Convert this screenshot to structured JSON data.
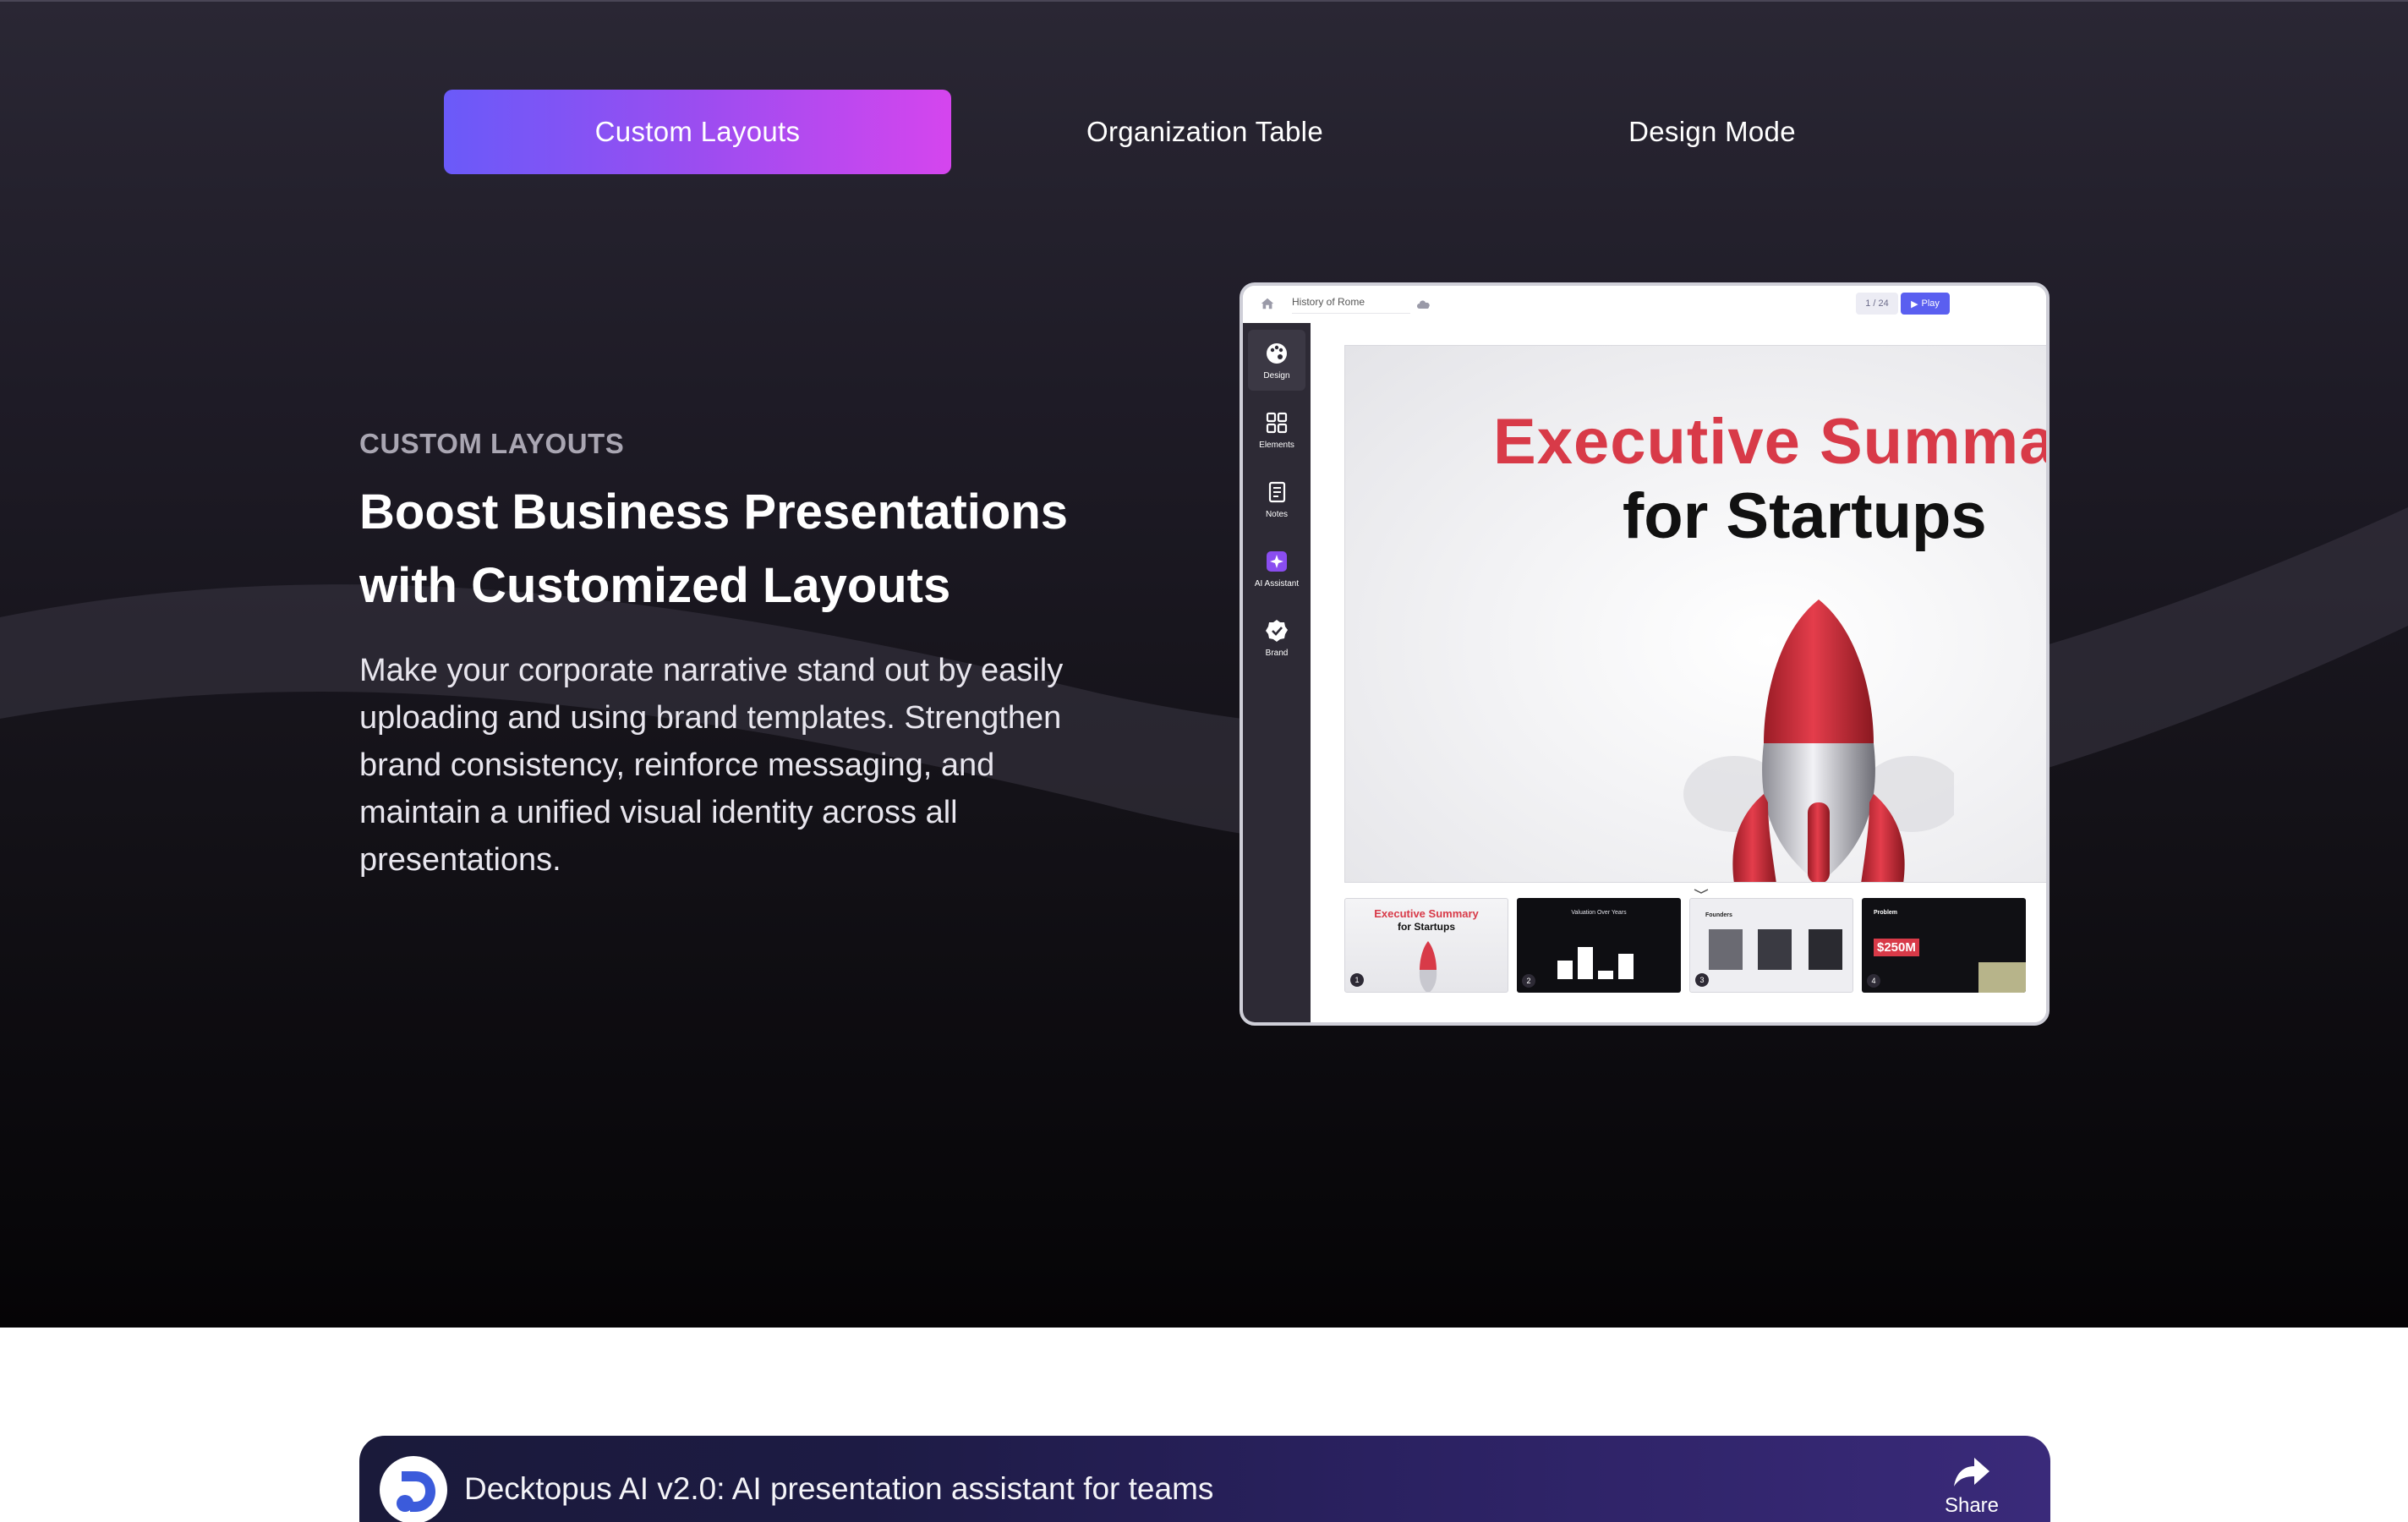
{
  "tabs": [
    {
      "label": "Custom Layouts",
      "active": true
    },
    {
      "label": "Organization Table",
      "active": false
    },
    {
      "label": "Design Mode",
      "active": false
    }
  ],
  "feature": {
    "eyebrow": "CUSTOM LAYOUTS",
    "headline": "Boost Business Presentations with Customized Layouts",
    "description": "Make your corporate narrative stand out by easily uploading and using brand templates. Strengthen brand consistency, reinforce messaging, and maintain a unified visual identity across all presentations."
  },
  "mockup": {
    "doc_title": "History of Rome",
    "page_count": "1 / 24",
    "play_label": "Play",
    "sidebar": [
      {
        "label": "Design",
        "icon": "palette-icon",
        "active": true
      },
      {
        "label": "Elements",
        "icon": "grid-icon",
        "active": false
      },
      {
        "label": "Notes",
        "icon": "notes-icon",
        "active": false
      },
      {
        "label": "AI Assistant",
        "icon": "sparkle-icon",
        "active": false
      },
      {
        "label": "Brand",
        "icon": "badge-check-icon",
        "active": false
      }
    ],
    "slide": {
      "title_line1": "Executive Summa",
      "title_line2": "for Startups"
    },
    "thumbnails": [
      {
        "number": "1",
        "title": "Executive Summary",
        "subtitle": "for Startups"
      },
      {
        "number": "2",
        "title": "Valuation Over Years"
      },
      {
        "number": "3",
        "title": "Founders"
      },
      {
        "number": "4",
        "title": "Problem",
        "value": "$250M"
      }
    ]
  },
  "video": {
    "title": "Decktopus AI v2.0: AI presentation assistant for teams",
    "share_label": "Share"
  },
  "colors": {
    "accent_gradient_start": "#6a5af9",
    "accent_gradient_end": "#d545ee",
    "brand_red": "#d83a48",
    "play_blue": "#5a5ff0"
  }
}
